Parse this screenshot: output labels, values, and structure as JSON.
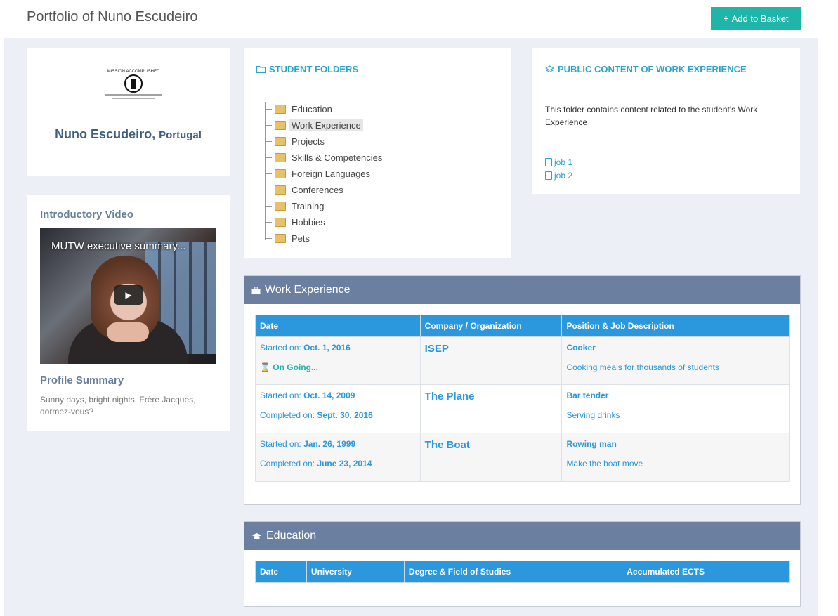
{
  "header": {
    "title": "Portfolio of Nuno Escudeiro",
    "add_button": "Add to Basket"
  },
  "profile": {
    "name": "Nuno Escudeiro,",
    "country": "Portugal",
    "logo_text": "MISSION ACCOMPLISHED"
  },
  "video": {
    "heading": "Introductory Video",
    "title": "MUTW executive summary..."
  },
  "summary": {
    "heading": "Profile Summary",
    "text": "Sunny days, bright nights. Frère Jacques, dormez-vous?"
  },
  "folders": {
    "heading": "STUDENT FOLDERS",
    "items": [
      {
        "label": "Education",
        "selected": false
      },
      {
        "label": "Work Experience",
        "selected": true
      },
      {
        "label": "Projects",
        "selected": false
      },
      {
        "label": "Skills & Competencies",
        "selected": false
      },
      {
        "label": "Foreign Languages",
        "selected": false
      },
      {
        "label": "Conferences",
        "selected": false
      },
      {
        "label": "Training",
        "selected": false
      },
      {
        "label": "Hobbies",
        "selected": false
      },
      {
        "label": "Pets",
        "selected": false
      }
    ]
  },
  "public_content": {
    "heading": "PUBLIC CONTENT OF WORK EXPERIENCE",
    "description": "This folder contains content related to the student's Work Experience",
    "files": [
      "job 1",
      "job 2"
    ]
  },
  "work": {
    "title": "Work Experience",
    "columns": [
      "Date",
      "Company / Organization",
      "Position & Job Description"
    ],
    "started_label": "Started on:",
    "completed_label": "Completed on:",
    "ongoing_label": "On Going...",
    "rows": [
      {
        "started": "Oct. 1, 2016",
        "completed": null,
        "company": "ISEP",
        "position": "Cooker",
        "description": "Cooking meals for thousands of students"
      },
      {
        "started": "Oct. 14, 2009",
        "completed": "Sept. 30, 2016",
        "company": "The Plane",
        "position": "Bar tender",
        "description": "Serving drinks"
      },
      {
        "started": "Jan. 26, 1999",
        "completed": "June 23, 2014",
        "company": "The Boat",
        "position": "Rowing man",
        "description": "Make the boat move"
      }
    ]
  },
  "education": {
    "title": "Education",
    "columns": [
      "Date",
      "University",
      "Degree & Field of Studies",
      "Accumulated ECTS"
    ]
  },
  "colors": {
    "accent": "#2b97dc",
    "teal": "#1fb5a8",
    "panel_header": "#6b7fa0"
  }
}
